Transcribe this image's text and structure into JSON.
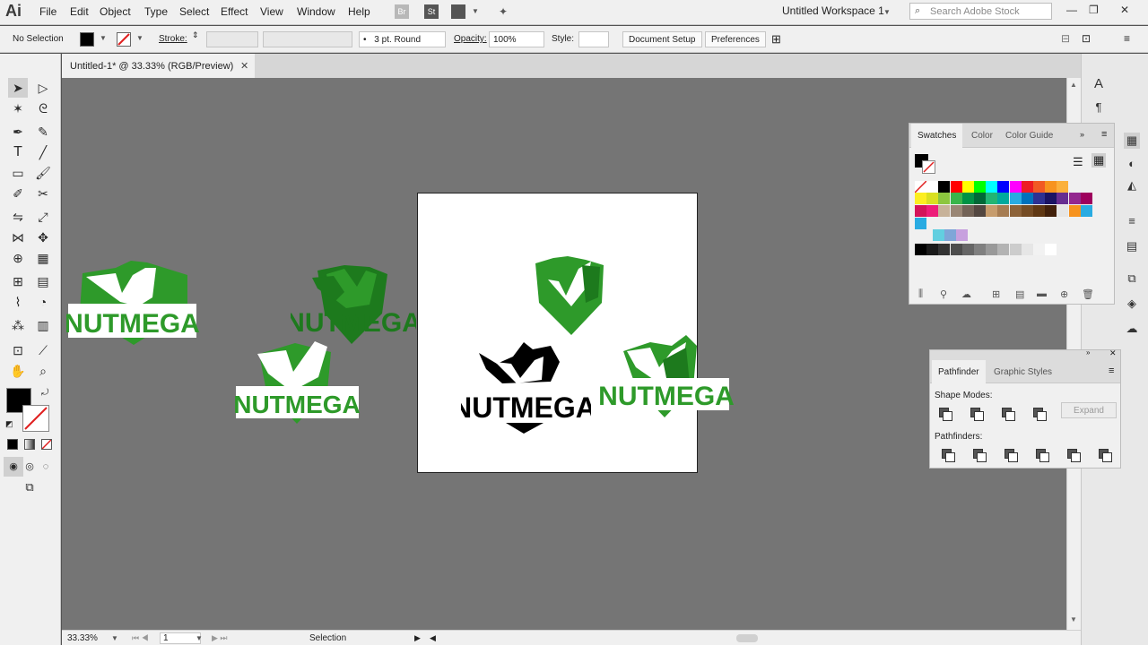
{
  "app": {
    "logo": "Ai"
  },
  "menu": [
    "File",
    "Edit",
    "Object",
    "Type",
    "Select",
    "Effect",
    "View",
    "Window",
    "Help"
  ],
  "menubar": {
    "bridge_icon": "Br",
    "stock_icon": "St",
    "workspace": "Untitled Workspace 1",
    "search_placeholder": "Search Adobe Stock",
    "search_glyph": "⌕"
  },
  "control": {
    "selection": "No Selection",
    "stroke_label": "Stroke:",
    "brush": "3 pt. Round",
    "brush_dot": "•",
    "opacity_label": "Opacity:",
    "opacity": "100%",
    "style_label": "Style:",
    "document_setup": "Document Setup",
    "preferences": "Preferences"
  },
  "document": {
    "tab_title": "Untitled-1* @ 33.33% (RGB/Preview)",
    "close": "✕"
  },
  "artwork": {
    "logo_text": "NUTMEGA"
  },
  "status": {
    "zoom": "33.33%",
    "artboard_num": "1",
    "tool": "Selection"
  },
  "swatches_panel": {
    "tabs": [
      "Swatches",
      "Color",
      "Color Guide"
    ]
  },
  "pathfinder_panel": {
    "tabs": [
      "Pathfinder",
      "Graphic Styles"
    ],
    "shape_modes": "Shape Modes:",
    "pathfinders": "Pathfinders:",
    "expand": "Expand"
  },
  "colors": {
    "accent_green": "#2e9a2a",
    "accent_dark_green": "#1d7a1d",
    "canvas_bg": "#757575",
    "fill_black": "#000000"
  }
}
